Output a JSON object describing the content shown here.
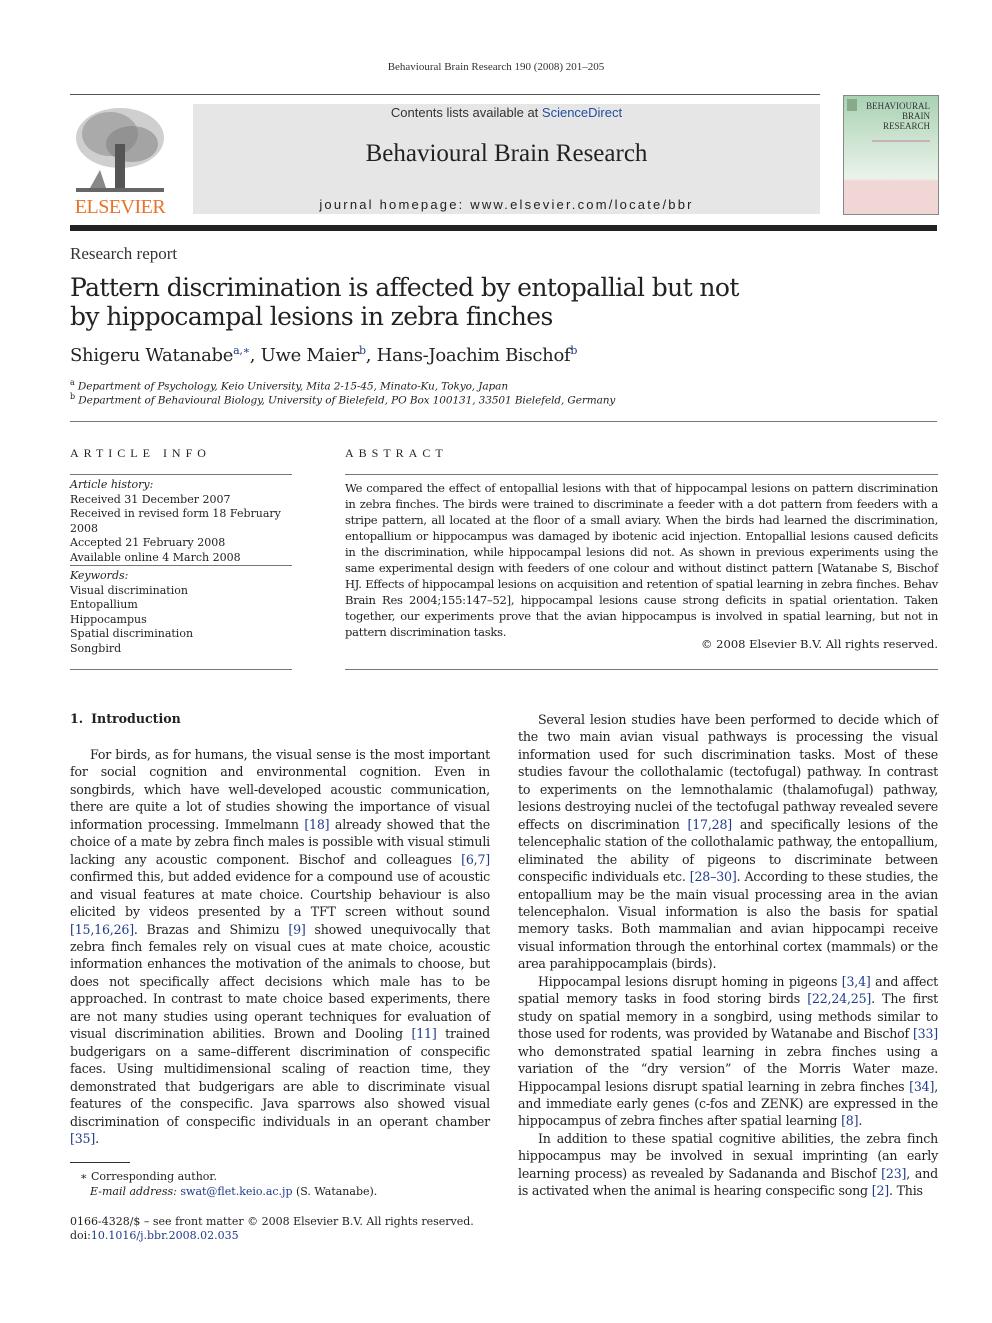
{
  "running_head": "Behavioural Brain Research 190 (2008) 201–205",
  "masthead": {
    "contents_prefix": "Contents lists available at ",
    "contents_link": "ScienceDirect",
    "journal_title": "Behavioural Brain Research",
    "homepage": "journal homepage: www.elsevier.com/locate/bbr",
    "publisher_logo_text": "ELSEVIER",
    "cover_title_lines": [
      "BEHAVIOURAL",
      "BRAIN",
      "RESEARCH"
    ],
    "colors": {
      "brand_orange": "#e8732a",
      "link_blue": "#1f4e9c"
    }
  },
  "article_type": "Research report",
  "title": "Pattern discrimination is affected by entopallial but not by hippocampal lesions in zebra finches",
  "authors": [
    {
      "name": "Shigeru Watanabe",
      "sup": "a,∗"
    },
    {
      "name": "Uwe Maier",
      "sup": "b"
    },
    {
      "name": "Hans-Joachim Bischof",
      "sup": "b"
    }
  ],
  "affiliations": [
    {
      "sup": "a",
      "text": "Department of Psychology, Keio University, Mita 2-15-45, Minato-Ku, Tokyo, Japan"
    },
    {
      "sup": "b",
      "text": "Department of Behavioural Biology, University of Bielefeld, PO Box 100131, 33501 Bielefeld, Germany"
    }
  ],
  "article_info": {
    "heading": "ARTICLE INFO",
    "history_label": "Article history:",
    "history": [
      "Received 31 December 2007",
      "Received in revised form 18 February 2008",
      "Accepted 21 February 2008",
      "Available online 4 March 2008"
    ],
    "keywords_label": "Keywords:",
    "keywords": [
      "Visual discrimination",
      "Entopallium",
      "Hippocampus",
      "Spatial discrimination",
      "Songbird"
    ]
  },
  "abstract": {
    "heading": "ABSTRACT",
    "text": "We compared the effect of entopallial lesions with that of hippocampal lesions on pattern discrimination in zebra finches. The birds were trained to discriminate a feeder with a dot pattern from feeders with a stripe pattern, all located at the floor of a small aviary. When the birds had learned the discrimination, entopallium or hippocampus was damaged by ibotenic acid injection. Entopallial lesions caused deficits in the discrimination, while hippocampal lesions did not. As shown in previous experiments using the same experimental design with feeders of one colour and without distinct pattern [Watanabe S, Bischof HJ. Effects of hippocampal lesions on acquisition and retention of spatial learning in zebra finches. Behav Brain Res 2004;155:147–52], hippocampal lesions cause strong deficits in spatial orientation. Taken together, our experiments prove that the avian hippocampus is involved in spatial learning, but not in pattern discrimination tasks.",
    "copyright": "© 2008 Elsevier B.V. All rights reserved."
  },
  "introduction": {
    "number": "1.",
    "heading": "Introduction",
    "left_paragraphs": [
      [
        {
          "t": "For birds, as for humans, the visual sense is the most important for social cognition and environmental cognition. Even in songbirds, which have well-developed acoustic communication, there are quite a lot of studies showing the importance of visual information processing. Immelmann "
        },
        {
          "r": "[18]"
        },
        {
          "t": " already showed that the choice of a mate by zebra finch males is possible with visual stimuli lacking any acoustic component. Bischof and colleagues "
        },
        {
          "r": "[6,7]"
        },
        {
          "t": " confirmed this, but added evidence for a compound use of acoustic and visual features at mate choice. Courtship behaviour is also elicited by videos presented by a TFT screen without sound "
        },
        {
          "r": "[15,16,26]"
        },
        {
          "t": ". Brazas and Shimizu "
        },
        {
          "r": "[9]"
        },
        {
          "t": " showed unequivocally that zebra finch females rely on visual cues at mate choice, acoustic information enhances the motivation of the animals to choose, but does not specifically affect decisions which male has to be approached. In contrast to mate choice based experiments, there are not many studies using operant techniques for evaluation of visual discrimination abilities. Brown and Dooling "
        },
        {
          "r": "[11]"
        },
        {
          "t": " trained budgerigars on a same–different discrimination of conspecific faces. Using multidimensional scaling of reaction time, they demonstrated that budgerigars are able to discriminate visual features of the conspecific. Java sparrows also showed visual discrimination of conspecific individuals in an operant chamber "
        },
        {
          "r": "[35]"
        },
        {
          "t": "."
        }
      ]
    ],
    "right_paragraphs": [
      [
        {
          "t": "Several lesion studies have been performed to decide which of the two main avian visual pathways is processing the visual information used for such discrimination tasks. Most of these studies favour the collothalamic (tectofugal) pathway. In contrast to experiments on the lemnothalamic (thalamofugal) pathway, lesions destroying nuclei of the tectofugal pathway revealed severe effects on discrimination "
        },
        {
          "r": "[17,28]"
        },
        {
          "t": " and specifically lesions of the telencephalic station of the collothalamic pathway, the entopallium, eliminated the ability of pigeons to discriminate between conspecific individuals etc. "
        },
        {
          "r": "[28–30]"
        },
        {
          "t": ". According to these studies, the entopallium may be the main visual processing area in the avian telencephalon. Visual information is also the basis for spatial memory tasks. Both mammalian and avian hippocampi receive visual information through the entorhinal cortex (mammals) or the area parahippocamplais (birds)."
        }
      ],
      [
        {
          "t": "Hippocampal lesions disrupt homing in pigeons "
        },
        {
          "r": "[3,4]"
        },
        {
          "t": " and affect spatial memory tasks in food storing birds "
        },
        {
          "r": "[22,24,25]"
        },
        {
          "t": ". The first study on spatial memory in a songbird, using methods similar to those used for rodents, was provided by Watanabe and Bischof "
        },
        {
          "r": "[33]"
        },
        {
          "t": " who demonstrated spatial learning in zebra finches using a variation of the “dry version” of the Morris Water maze. Hippocampal lesions disrupt spatial learning in zebra finches "
        },
        {
          "r": "[34]"
        },
        {
          "t": ", and immediate early genes (c-fos and ZENK) are expressed in the hippocampus of zebra finches after spatial learning "
        },
        {
          "r": "[8]"
        },
        {
          "t": "."
        }
      ],
      [
        {
          "t": "In addition to these spatial cognitive abilities, the zebra finch hippocampus may be involved in sexual imprinting (an early learning process) as revealed by Sadananda and Bischof "
        },
        {
          "r": "[23]"
        },
        {
          "t": ", and is activated when the animal is hearing conspecific song "
        },
        {
          "r": "[2]"
        },
        {
          "t": ". This"
        }
      ]
    ]
  },
  "footnote": {
    "marker": "∗",
    "corresponding": "Corresponding author.",
    "email_label": "E-mail address:",
    "email": "swat@flet.keio.ac.jp",
    "email_suffix": " (S. Watanabe)."
  },
  "front_matter": "0166-4328/$ – see front matter © 2008 Elsevier B.V. All rights reserved.",
  "doi_label": "doi:",
  "doi": "10.1016/j.bbr.2008.02.035"
}
